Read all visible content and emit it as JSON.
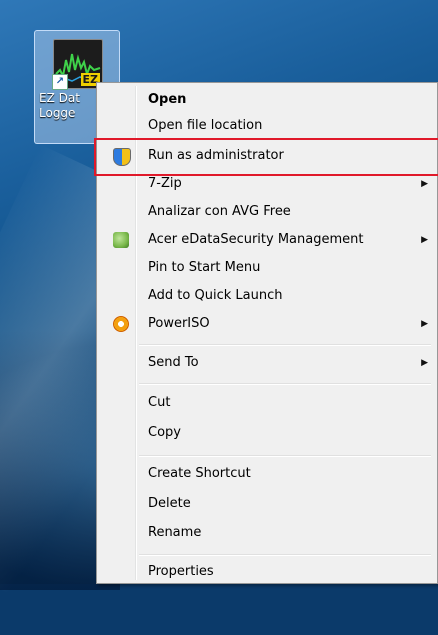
{
  "desktop_icon": {
    "label_line1": "EZ Dat",
    "label_line2": "Logge",
    "badge": "EZ"
  },
  "context_menu": {
    "items": [
      {
        "label": "Open",
        "bold": true
      },
      {
        "label": "Open file location"
      },
      {
        "label": "Run as administrator",
        "icon": "uac-shield-icon",
        "highlighted_by_red_box": true
      },
      {
        "label": "7-Zip",
        "submenu": true
      },
      {
        "label": "Analizar con AVG Free"
      },
      {
        "label": "Acer eDataSecurity Management",
        "icon": "acer-edatasecurity-icon",
        "submenu": true
      },
      {
        "label": "Pin to Start Menu"
      },
      {
        "label": "Add to Quick Launch"
      },
      {
        "label": "PowerISO",
        "icon": "poweriso-icon",
        "submenu": true
      },
      {
        "label": "Send To",
        "submenu": true
      },
      {
        "label": "Cut"
      },
      {
        "label": "Copy"
      },
      {
        "label": "Create Shortcut"
      },
      {
        "label": "Delete"
      },
      {
        "label": "Rename"
      },
      {
        "label": "Properties"
      }
    ],
    "submenu_glyph": "▶"
  },
  "colors": {
    "highlight_box": "#e0192a",
    "menu_background": "#f0f0f0"
  }
}
